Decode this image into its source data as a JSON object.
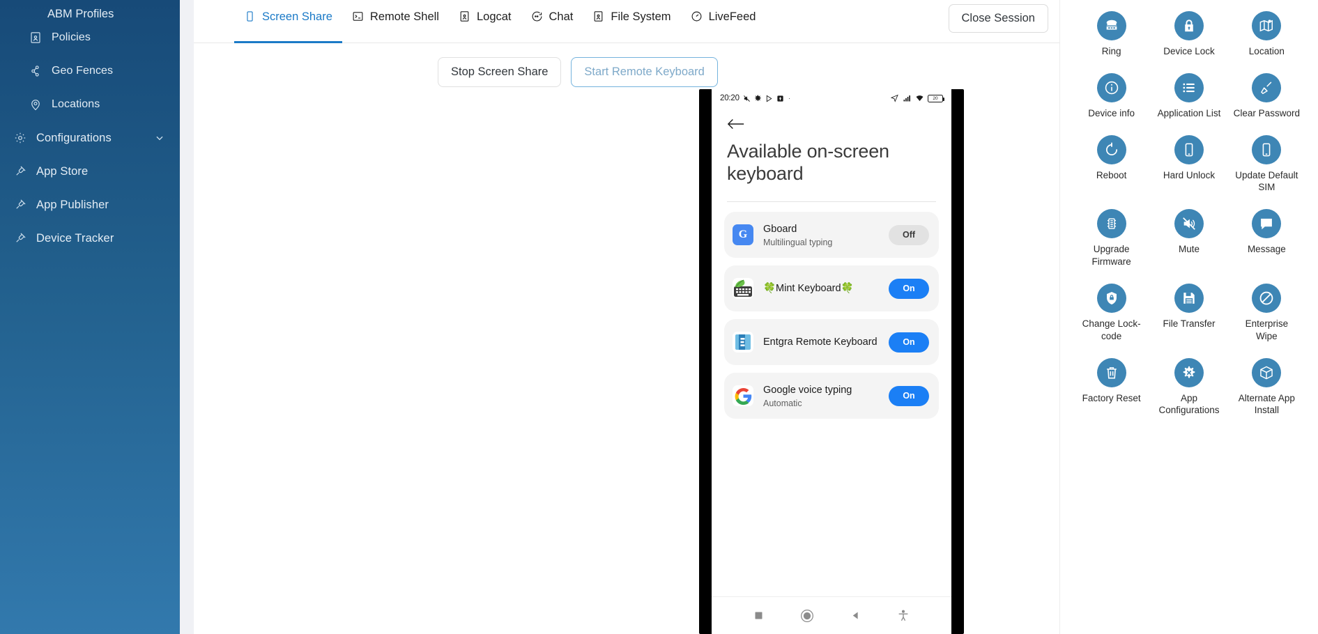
{
  "sidebar": {
    "top_partial_label": "ABM Profiles",
    "items": [
      {
        "label": "Policies",
        "icon": "policy-icon",
        "sub": true,
        "expandable": false
      },
      {
        "label": "Geo Fences",
        "icon": "geofence-icon",
        "sub": true,
        "expandable": false
      },
      {
        "label": "Locations",
        "icon": "location-pin-icon",
        "sub": true,
        "expandable": false
      },
      {
        "label": "Configurations",
        "icon": "gear-icon",
        "sub": false,
        "expandable": true
      },
      {
        "label": "App Store",
        "icon": "plug-icon",
        "sub": false,
        "expandable": false
      },
      {
        "label": "App Publisher",
        "icon": "plug-icon",
        "sub": false,
        "expandable": false
      },
      {
        "label": "Device Tracker",
        "icon": "plug-icon",
        "sub": false,
        "expandable": false
      }
    ]
  },
  "main": {
    "tabs": [
      {
        "label": "Screen Share",
        "icon": "mobile-screen-icon",
        "active": true
      },
      {
        "label": "Remote Shell",
        "icon": "terminal-icon",
        "active": false
      },
      {
        "label": "Logcat",
        "icon": "log-icon",
        "active": false
      },
      {
        "label": "Chat",
        "icon": "chat-bubble-icon",
        "active": false
      },
      {
        "label": "File System",
        "icon": "file-system-icon",
        "active": false
      },
      {
        "label": "LiveFeed",
        "icon": "gauge-icon",
        "active": false
      }
    ],
    "close_session_label": "Close Session",
    "actions": [
      {
        "label": "Stop Screen Share",
        "style": "default"
      },
      {
        "label": "Start Remote Keyboard",
        "style": "outline-blue"
      }
    ]
  },
  "phone": {
    "status_bar": {
      "clock": "20:20",
      "left_icons": [
        "no-sound-icon",
        "gear-icon",
        "play-store-icon",
        "upload-icon",
        "dot-icon"
      ],
      "right_icons": [
        "location-arrow-icon",
        "signal-bars-icon",
        "wifi-icon"
      ],
      "battery_level": "20"
    },
    "back_icon": "arrow-left-icon",
    "title": "Available on-screen keyboard",
    "keyboards": [
      {
        "name": "Gboard",
        "subtitle": "Multilingual typing",
        "toggle": "Off",
        "state": "off",
        "icon": "gboard-icon"
      },
      {
        "name": "🍀Mint Keyboard🍀",
        "subtitle": "",
        "toggle": "On",
        "state": "on",
        "icon": "mint-keyboard-icon"
      },
      {
        "name": "Entgra Remote Keyboard",
        "subtitle": "",
        "toggle": "On",
        "state": "on",
        "icon": "entgra-icon"
      },
      {
        "name": "Google voice typing",
        "subtitle": "Automatic",
        "toggle": "On",
        "state": "on",
        "icon": "google-icon"
      }
    ],
    "nav_buttons": [
      "recents-square-icon",
      "home-circle-icon",
      "back-triangle-icon",
      "accessibility-icon"
    ]
  },
  "right_panel": {
    "operations": [
      {
        "label": "Ring",
        "icon": "ring-phone-icon"
      },
      {
        "label": "Device Lock",
        "icon": "lock-icon"
      },
      {
        "label": "Location",
        "icon": "map-icon"
      },
      {
        "label": "Device info",
        "icon": "info-icon"
      },
      {
        "label": "Application List",
        "icon": "list-icon"
      },
      {
        "label": "Clear Password",
        "icon": "broom-icon"
      },
      {
        "label": "Reboot",
        "icon": "refresh-icon"
      },
      {
        "label": "Hard Unlock",
        "icon": "mobile-icon"
      },
      {
        "label": "Update Default SIM",
        "icon": "mobile-icon"
      },
      {
        "label": "Upgrade Firmware",
        "icon": "chip-icon"
      },
      {
        "label": "Mute",
        "icon": "mute-icon"
      },
      {
        "label": "Message",
        "icon": "message-icon"
      },
      {
        "label": "Change Lock-code",
        "icon": "shield-lock-icon"
      },
      {
        "label": "File Transfer",
        "icon": "floppy-disk-icon"
      },
      {
        "label": "Enterprise Wipe",
        "icon": "ban-icon"
      },
      {
        "label": "Factory Reset",
        "icon": "trash-icon"
      },
      {
        "label": "App Configurations",
        "icon": "gear-x-icon"
      },
      {
        "label": "Alternate App Install",
        "icon": "box-icon"
      }
    ]
  },
  "colors": {
    "sidebar_top": "#174a78",
    "sidebar_bottom": "#3279ad",
    "accent_blue": "#1b7ac7",
    "op_circle": "#3e86b5",
    "toggle_on": "#1b7ff5",
    "toggle_off": "#e2e2e2",
    "gutter": "#f0f1f5"
  }
}
